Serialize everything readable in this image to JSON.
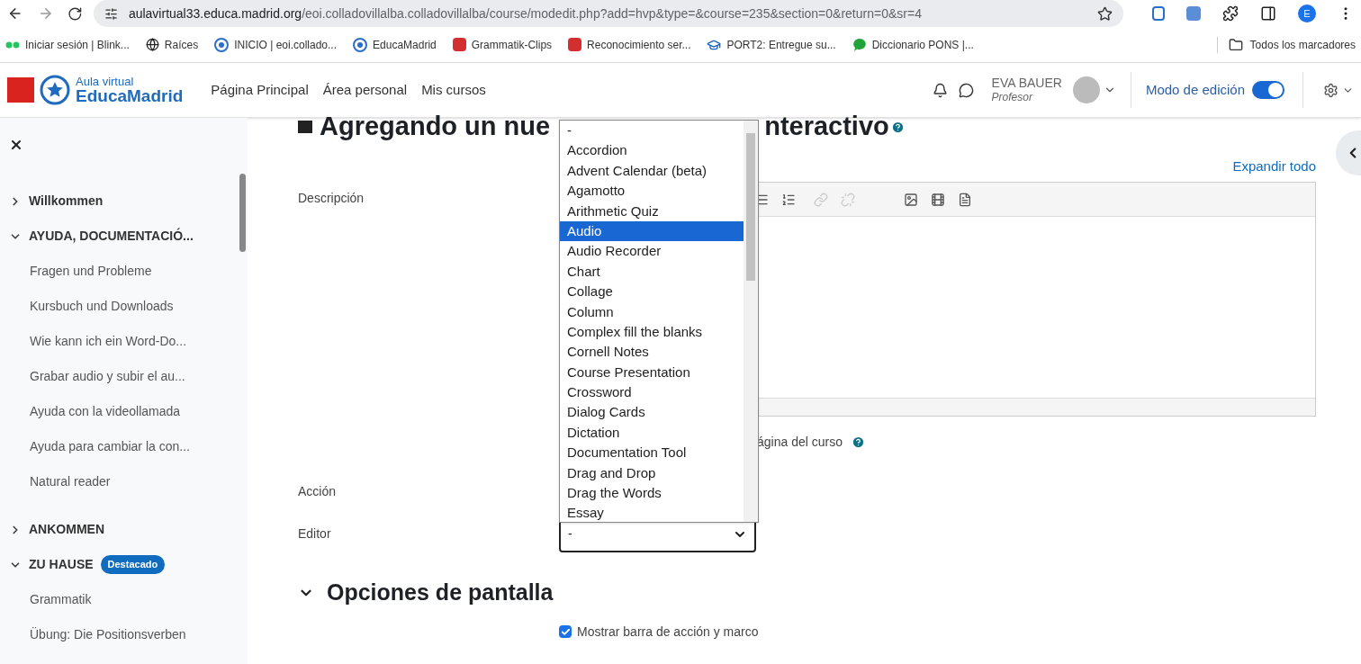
{
  "browser": {
    "url_host": "aulavirtual33.educa.madrid.org",
    "url_path": "/eoi.colladovillalba.colladovillalba/course/modedit.php?add=hvp&type=&course=235&section=0&return=0&sr=4",
    "profile_initial": "E",
    "bookmarks": [
      {
        "label": "Iniciar sesión | Blink...",
        "kind": "dots"
      },
      {
        "label": "Raíces",
        "kind": "globe"
      },
      {
        "label": "INICIO | eoi.collado...",
        "kind": "wheel"
      },
      {
        "label": "EducaMadrid",
        "kind": "wheel"
      },
      {
        "label": "Grammatik-Clips",
        "kind": "red"
      },
      {
        "label": "Reconocimiento ser...",
        "kind": "red"
      },
      {
        "label": "PORT2: Entregue su...",
        "kind": "cap"
      },
      {
        "label": "Diccionario PONS |...",
        "kind": "bubble"
      }
    ],
    "all_bookmarks": "Todos los marcadores"
  },
  "header": {
    "logo_small": "Aula virtual",
    "logo_big": "EducaMadrid",
    "nav": [
      "Página Principal",
      "Área personal",
      "Mis cursos"
    ],
    "user_name": "EVA BAUER",
    "user_role": "Profesor",
    "edit_mode_label": "Modo de edición",
    "edit_mode_on": true
  },
  "sidebar": {
    "items": [
      {
        "label": "Willkommen",
        "expanded": false
      },
      {
        "label": "AYUDA, DOCUMENTACIÓ...",
        "expanded": true,
        "children": [
          {
            "label": "Fragen und Probleme"
          },
          {
            "label": "Kursbuch und Downloads"
          },
          {
            "label": "Wie kann ich ein Word-Do..."
          },
          {
            "label": "Grabar audio y subir el au..."
          },
          {
            "label": "Ayuda con la videollamada"
          },
          {
            "label": "Ayuda para cambiar la con..."
          },
          {
            "label": "Natural reader"
          }
        ]
      },
      {
        "label": "ANKOMMEN",
        "expanded": false
      },
      {
        "label": "ZU HAUSE",
        "badge": "Destacado",
        "expanded": true,
        "children": [
          {
            "label": "Grammatik"
          },
          {
            "label": "Übung: Die Positionsverben"
          }
        ]
      }
    ]
  },
  "main": {
    "title_start": "Agregando un nue",
    "title_end": "nteractivo",
    "expand_all": "Expandir todo",
    "description_label": "Descripción",
    "show_on_page_partial": "ágina del curso",
    "action_label": "Acción",
    "editor_label": "Editor",
    "editor_value": "-",
    "section_title": "Opciones de pantalla",
    "section_expanded": true,
    "checkbox": {
      "label": "Mostrar barra de acción y marco",
      "checked": true
    }
  },
  "dropdown": {
    "options": [
      {
        "label": "-",
        "selected": false
      },
      {
        "label": "Accordion",
        "selected": false
      },
      {
        "label": "Advent Calendar (beta)",
        "selected": false
      },
      {
        "label": "Agamotto",
        "selected": false
      },
      {
        "label": "Arithmetic Quiz",
        "selected": false
      },
      {
        "label": "Audio",
        "selected": true
      },
      {
        "label": "Audio Recorder",
        "selected": false
      },
      {
        "label": "Chart",
        "selected": false
      },
      {
        "label": "Collage",
        "selected": false
      },
      {
        "label": "Column",
        "selected": false
      },
      {
        "label": "Complex fill the blanks",
        "selected": false
      },
      {
        "label": "Cornell Notes",
        "selected": false
      },
      {
        "label": "Course Presentation",
        "selected": false
      },
      {
        "label": "Crossword",
        "selected": false
      },
      {
        "label": "Dialog Cards",
        "selected": false
      },
      {
        "label": "Dictation",
        "selected": false
      },
      {
        "label": "Documentation Tool",
        "selected": false
      },
      {
        "label": "Drag and Drop",
        "selected": false
      },
      {
        "label": "Drag the Words",
        "selected": false
      },
      {
        "label": "Essay",
        "selected": false
      }
    ]
  }
}
